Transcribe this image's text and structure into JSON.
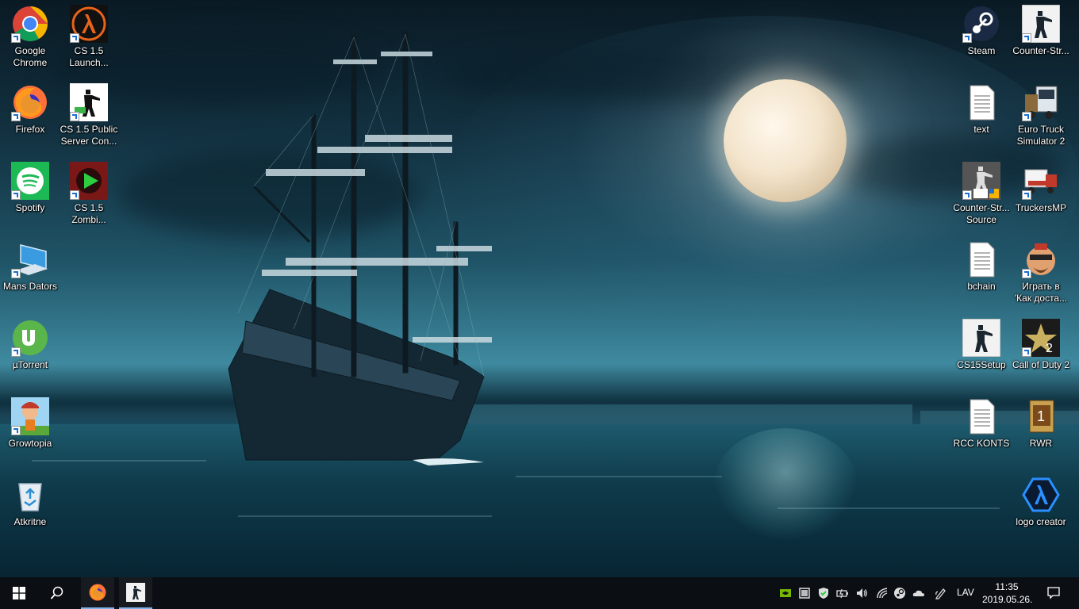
{
  "desktop": {
    "left_icons": [
      {
        "label": "Google\nChrome",
        "icon": "chrome-icon"
      },
      {
        "label": "CS 1.5\nLaunch...",
        "icon": "half-life-lambda-icon"
      },
      {
        "label": "Firefox",
        "icon": "firefox-icon"
      },
      {
        "label": "CS 1.5 Public\nServer Con...",
        "icon": "counter-strike-soldier-icon"
      },
      {
        "label": "Spotify",
        "icon": "spotify-icon"
      },
      {
        "label": "CS 1.5\nZombi...",
        "icon": "biohazard-play-icon"
      },
      {
        "label": "Mans Dators",
        "icon": "this-pc-icon"
      },
      {
        "label": "µTorrent",
        "icon": "utorrent-icon"
      },
      {
        "label": "Growtopia",
        "icon": "growtopia-icon"
      },
      {
        "label": "Atkritne",
        "icon": "recycle-bin-icon"
      }
    ],
    "right_icons": [
      {
        "label": "Steam",
        "icon": "steam-icon"
      },
      {
        "label": "Counter-Str...",
        "icon": "counter-strike-icon"
      },
      {
        "label": "text",
        "icon": "text-file-icon"
      },
      {
        "label": "Euro Truck\nSimulator 2",
        "icon": "euro-truck-icon"
      },
      {
        "label": "Counter-Str...\nSource",
        "icon": "cs-source-icon"
      },
      {
        "label": "TruckersMP",
        "icon": "truckersmp-icon"
      },
      {
        "label": "bchain",
        "icon": "text-file-icon"
      },
      {
        "label": "Играть в\n'Как доста...",
        "icon": "game-character-icon"
      },
      {
        "label": "CS15Setup",
        "icon": "counter-strike-setup-icon"
      },
      {
        "label": "Call of Duty 2",
        "icon": "call-of-duty-2-icon"
      },
      {
        "label": "RCC KONTS",
        "icon": "text-file-icon"
      },
      {
        "label": "RWR",
        "icon": "rwr-icon"
      },
      {
        "label": "logo creator",
        "icon": "lambda-logo-icon"
      }
    ]
  },
  "taskbar": {
    "start": "windows-start-icon",
    "search": "search-icon",
    "pinned": [
      {
        "app": "Firefox",
        "icon": "firefox-icon",
        "active": true
      },
      {
        "app": "Counter-Strike",
        "icon": "counter-strike-icon",
        "active": true
      }
    ],
    "tray": {
      "language": "LAV",
      "time": "11:35",
      "date": "2019.05.26.",
      "icons": [
        "nvidia-icon",
        "storage-icon",
        "security-shield-icon",
        "power-icon",
        "volume-icon",
        "wifi-icon",
        "steam-tray-icon",
        "onedrive-icon",
        "pen-icon"
      ]
    },
    "notification": "action-center-icon"
  },
  "colors": {
    "taskbar_bg": "#0b0f14",
    "active_indicator": "#7fb3e6"
  }
}
